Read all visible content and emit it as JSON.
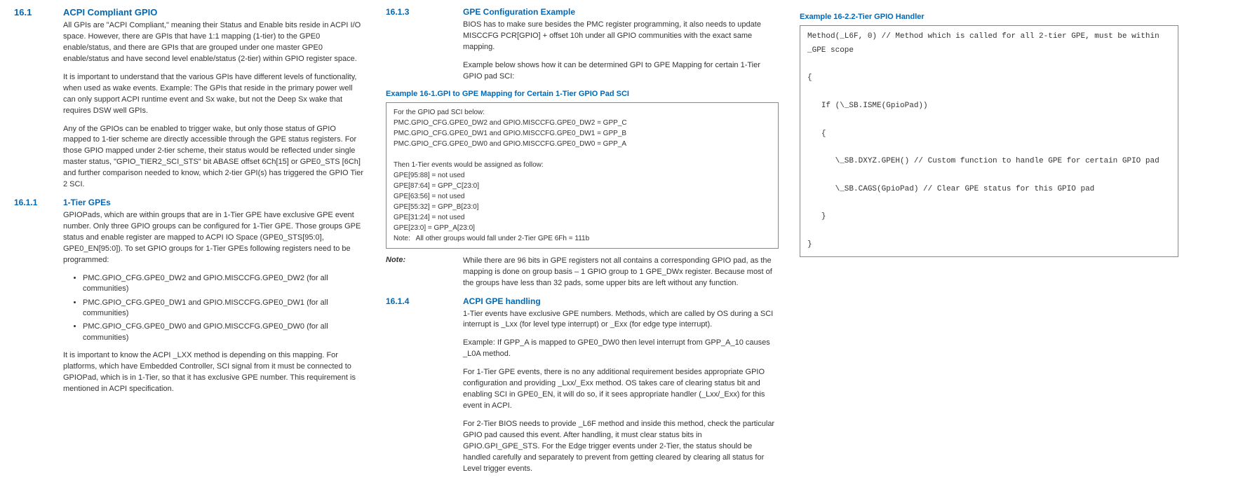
{
  "col1": {
    "s1_no": "16.1",
    "s1_title": "ACPI Compliant GPIO",
    "p1": "All GPIs are \"ACPI Compliant,\" meaning their Status and Enable bits reside in ACPI I/O space. However, there are GPIs that have 1:1 mapping (1-tier) to the GPE0 enable/status, and there are GPIs that are grouped under one master GPE0 enable/status and have second level enable/status (2-tier) within GPIO register space.",
    "p2": "It is important to understand that the various GPIs have different levels of functionality, when used as wake events. Example: The GPIs that reside in the primary power well can only support ACPI runtime event and Sx wake, but not the Deep Sx wake that requires DSW well GPIs.",
    "p3": "Any of the GPIOs can be enabled to trigger wake, but only those status of GPIO mapped to 1-tier scheme are directly accessible through the GPE status registers. For those GPIO mapped under 2-tier scheme, their status would be reflected under single master status, \"GPIO_TIER2_SCI_STS\" bit ABASE offset 6Ch[15] or GPE0_STS [6Ch] and further comparison needed to know, which 2-tier GPI(s) has triggered the GPIO Tier 2 SCI.",
    "s2_no": "16.1.1",
    "s2_title": "1-Tier GPEs",
    "p4": "GPIOPads, which are within groups that are in 1-Tier GPE have exclusive GPE event number. Only three GPIO groups can be configured for 1-Tier GPE. Those groups GPE status and enable register are mapped to ACPI IO Space (GPE0_STS[95:0], GPE0_EN[95:0]). To set GPIO groups for 1-Tier GPEs following registers need to be programmed:",
    "b1": "PMC.GPIO_CFG.GPE0_DW2 and GPIO.MISCCFG.GPE0_DW2 (for all communities)",
    "b2": "PMC.GPIO_CFG.GPE0_DW1 and GPIO.MISCCFG.GPE0_DW1 (for all communities)",
    "b3": "PMC.GPIO_CFG.GPE0_DW0 and GPIO.MISCCFG.GPE0_DW0 (for all communities)",
    "p5": "It is important to know the ACPI _LXX method is depending on this mapping. For platforms, which have Embedded Controller, SCI signal from it must be connected to GPIOPad, which is in 1-Tier, so that it has exclusive GPE number. This requirement is mentioned in ACPI specification."
  },
  "col2": {
    "s3_no": "16.1.3",
    "s3_title": "GPE Configuration Example",
    "p1": "BIOS has to make sure besides the PMC register programming, it also needs to update MISCCFG PCR[GPIO] + offset 10h under all GPIO communities with the exact same mapping.",
    "p2": "Example below shows how it can be determined GPI to GPE Mapping for certain 1-Tier GPIO pad SCI:",
    "ex1_label": "Example 16-1.GPI to GPE Mapping for Certain 1-Tier GPIO Pad SCI",
    "ex1_body": "For the GPIO pad SCI below:\nPMC.GPIO_CFG.GPE0_DW2 and GPIO.MISCCFG.GPE0_DW2 = GPP_C\nPMC.GPIO_CFG.GPE0_DW1 and GPIO.MISCCFG.GPE0_DW1 = GPP_B\nPMC.GPIO_CFG.GPE0_DW0 and GPIO.MISCCFG.GPE0_DW0 = GPP_A\n\nThen 1-Tier events would be assigned as follow:\nGPE[95:88] = not used\nGPE[87:64] = GPP_C[23:0]\nGPE[63:56] = not used\nGPE[55:32] = GPP_B[23:0]\nGPE[31:24] = not used\nGPE[23:0] = GPP_A[23:0]\nNote:   All other groups would fall under 2-Tier GPE 6Fh = 111b",
    "note_label": "Note:",
    "note_body": "While there are 96 bits in GPE registers not all contains a corresponding GPIO pad, as the mapping is done on group basis – 1 GPIO group to 1 GPE_DWx register. Because most of the groups have less than 32 pads, some upper bits are left without any function.",
    "s4_no": "16.1.4",
    "s4_title": "ACPI GPE handling",
    "p3": "1-Tier events have exclusive GPE numbers. Methods, which are called by OS during a SCI interrupt is _Lxx (for level type interrupt) or _Exx (for edge type interrupt).",
    "p4": "Example: If GPP_A is mapped to GPE0_DW0 then level interrupt from GPP_A_10 causes _L0A method.",
    "p5": "For 1-Tier GPE events, there is no any additional requirement besides appropriate GPIO configuration and providing _Lxx/_Exx method. OS takes care of clearing status bit and enabling SCI in GPE0_EN, it will do so, if it sees appropriate handler (_Lxx/_Exx) for this event in ACPI.",
    "p6": "For 2-Tier BIOS needs to provide _L6F method and inside this method, check the particular GPIO pad caused this event. After handling, it must clear status bits in GPIO.GPI_GPE_STS. For the Edge trigger events under 2-Tier, the status should be handled carefully and separately to prevent from getting cleared by clearing all status for Level trigger events."
  },
  "col3": {
    "ex2_label": "Example 16-2.2-Tier GPIO Handler",
    "ex2_body": "Method(_L6F, 0) // Method which is called for all 2-tier GPE, must be within _GPE scope\n\n{\n\n   If (\\_SB.ISME(GpioPad))\n\n   {\n\n      \\_SB.DXYZ.GPEH() // Custom function to handle GPE for certain GPIO pad\n\n      \\_SB.CAGS(GpioPad) // Clear GPE status for this GPIO pad\n\n   }\n\n}"
  }
}
